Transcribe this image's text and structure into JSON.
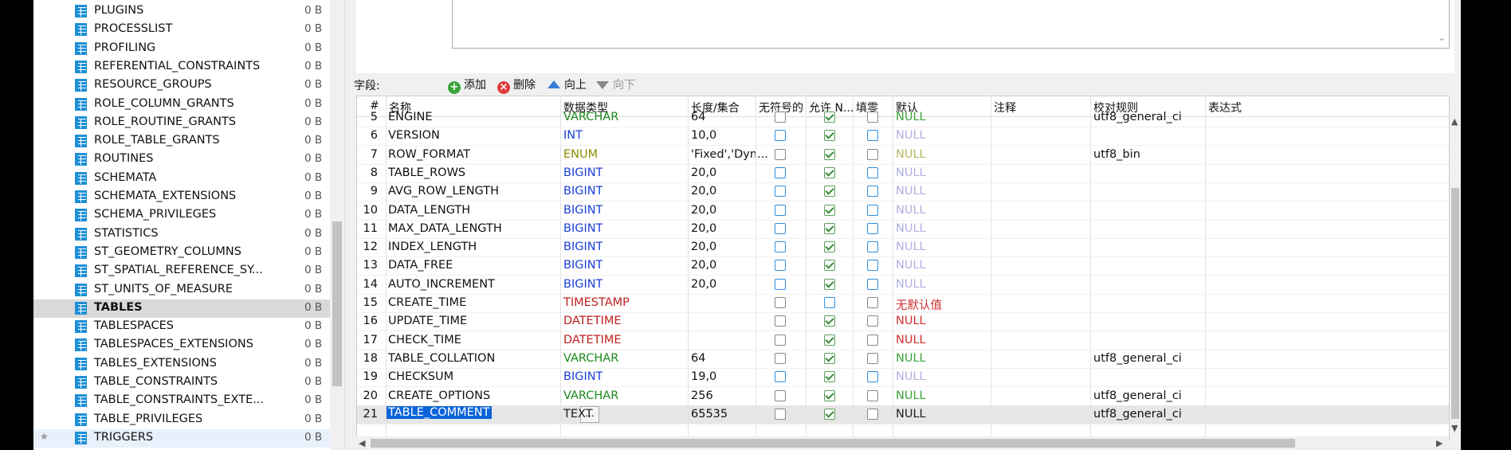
{
  "tree": {
    "items": [
      {
        "name": "PLUGINS",
        "size": "0 B"
      },
      {
        "name": "PROCESSLIST",
        "size": "0 B"
      },
      {
        "name": "PROFILING",
        "size": "0 B"
      },
      {
        "name": "REFERENTIAL_CONSTRAINTS",
        "size": "0 B"
      },
      {
        "name": "RESOURCE_GROUPS",
        "size": "0 B"
      },
      {
        "name": "ROLE_COLUMN_GRANTS",
        "size": "0 B"
      },
      {
        "name": "ROLE_ROUTINE_GRANTS",
        "size": "0 B"
      },
      {
        "name": "ROLE_TABLE_GRANTS",
        "size": "0 B"
      },
      {
        "name": "ROUTINES",
        "size": "0 B"
      },
      {
        "name": "SCHEMATA",
        "size": "0 B"
      },
      {
        "name": "SCHEMATA_EXTENSIONS",
        "size": "0 B"
      },
      {
        "name": "SCHEMA_PRIVILEGES",
        "size": "0 B"
      },
      {
        "name": "STATISTICS",
        "size": "0 B"
      },
      {
        "name": "ST_GEOMETRY_COLUMNS",
        "size": "0 B"
      },
      {
        "name": "ST_SPATIAL_REFERENCE_SY...",
        "size": "0 B"
      },
      {
        "name": "ST_UNITS_OF_MEASURE",
        "size": "0 B"
      },
      {
        "name": "TABLES",
        "size": "0 B"
      },
      {
        "name": "TABLESPACES",
        "size": "0 B"
      },
      {
        "name": "TABLESPACES_EXTENSIONS",
        "size": "0 B"
      },
      {
        "name": "TABLES_EXTENSIONS",
        "size": "0 B"
      },
      {
        "name": "TABLE_CONSTRAINTS",
        "size": "0 B"
      },
      {
        "name": "TABLE_CONSTRAINTS_EXTE...",
        "size": "0 B"
      },
      {
        "name": "TABLE_PRIVILEGES",
        "size": "0 B"
      },
      {
        "name": "TRIGGERS",
        "size": "0 B"
      }
    ],
    "selected_index": 16,
    "highlight_index": 23,
    "star": "★"
  },
  "toolbar": {
    "fields_label": "字段:",
    "add": "添加",
    "delete": "删除",
    "up": "向上",
    "down": "向下"
  },
  "grid": {
    "headers": [
      "#",
      "名称",
      "数据类型",
      "长度/集合",
      "无符号的",
      "允许 N...",
      "填零",
      "默认",
      "注释",
      "校对规则",
      "表达式"
    ],
    "colors": {
      "VARCHAR": "#1a8a1a",
      "INT": "#1a3fd6",
      "BIGINT": "#1a3fd6",
      "ENUM": "#8a8a00",
      "TIMESTAMP": "#c02020",
      "DATETIME": "#c02020",
      "TEXT": "#222222"
    },
    "rows": [
      {
        "num": "5",
        "name": "ENGINE",
        "type": "VARCHAR",
        "len": "64",
        "unsigned": "off",
        "allow_null": "on",
        "zerofill": "off",
        "default": "NULL",
        "default_color": "#3aa53a",
        "collation": "utf8_general_ci"
      },
      {
        "num": "6",
        "name": "VERSION",
        "type": "INT",
        "len": "10,0",
        "unsigned": "blue",
        "allow_null": "on",
        "zerofill": "blue",
        "default": "NULL",
        "default_color": "#b0b0e0",
        "collation": ""
      },
      {
        "num": "7",
        "name": "ROW_FORMAT",
        "type": "ENUM",
        "len": "'Fixed','Dyn...",
        "unsigned": "off",
        "allow_null": "on",
        "zerofill": "off",
        "default": "NULL",
        "default_color": "#b5b560",
        "collation": "utf8_bin"
      },
      {
        "num": "8",
        "name": "TABLE_ROWS",
        "type": "BIGINT",
        "len": "20,0",
        "unsigned": "blue",
        "allow_null": "on",
        "zerofill": "blue",
        "default": "NULL",
        "default_color": "#b0b0e0",
        "collation": ""
      },
      {
        "num": "9",
        "name": "AVG_ROW_LENGTH",
        "type": "BIGINT",
        "len": "20,0",
        "unsigned": "blue",
        "allow_null": "on",
        "zerofill": "blue",
        "default": "NULL",
        "default_color": "#b0b0e0",
        "collation": ""
      },
      {
        "num": "10",
        "name": "DATA_LENGTH",
        "type": "BIGINT",
        "len": "20,0",
        "unsigned": "blue",
        "allow_null": "on",
        "zerofill": "blue",
        "default": "NULL",
        "default_color": "#b0b0e0",
        "collation": ""
      },
      {
        "num": "11",
        "name": "MAX_DATA_LENGTH",
        "type": "BIGINT",
        "len": "20,0",
        "unsigned": "blue",
        "allow_null": "on",
        "zerofill": "blue",
        "default": "NULL",
        "default_color": "#b0b0e0",
        "collation": ""
      },
      {
        "num": "12",
        "name": "INDEX_LENGTH",
        "type": "BIGINT",
        "len": "20,0",
        "unsigned": "blue",
        "allow_null": "on",
        "zerofill": "blue",
        "default": "NULL",
        "default_color": "#b0b0e0",
        "collation": ""
      },
      {
        "num": "13",
        "name": "DATA_FREE",
        "type": "BIGINT",
        "len": "20,0",
        "unsigned": "blue",
        "allow_null": "on",
        "zerofill": "blue",
        "default": "NULL",
        "default_color": "#b0b0e0",
        "collation": ""
      },
      {
        "num": "14",
        "name": "AUTO_INCREMENT",
        "type": "BIGINT",
        "len": "20,0",
        "unsigned": "blue",
        "allow_null": "on",
        "zerofill": "blue",
        "default": "NULL",
        "default_color": "#b0b0e0",
        "collation": ""
      },
      {
        "num": "15",
        "name": "CREATE_TIME",
        "type": "TIMESTAMP",
        "len": "",
        "unsigned": "off",
        "allow_null": "blue",
        "zerofill": "off",
        "default": "无默认值",
        "default_color": "#d03030",
        "collation": ""
      },
      {
        "num": "16",
        "name": "UPDATE_TIME",
        "type": "DATETIME",
        "len": "",
        "unsigned": "off",
        "allow_null": "on",
        "zerofill": "off",
        "default": "NULL",
        "default_color": "#d03030",
        "collation": ""
      },
      {
        "num": "17",
        "name": "CHECK_TIME",
        "type": "DATETIME",
        "len": "",
        "unsigned": "off",
        "allow_null": "on",
        "zerofill": "off",
        "default": "NULL",
        "default_color": "#d03030",
        "collation": ""
      },
      {
        "num": "18",
        "name": "TABLE_COLLATION",
        "type": "VARCHAR",
        "len": "64",
        "unsigned": "off",
        "allow_null": "on",
        "zerofill": "off",
        "default": "NULL",
        "default_color": "#3aa53a",
        "collation": "utf8_general_ci"
      },
      {
        "num": "19",
        "name": "CHECKSUM",
        "type": "BIGINT",
        "len": "19,0",
        "unsigned": "blue",
        "allow_null": "on",
        "zerofill": "blue",
        "default": "NULL",
        "default_color": "#b0b0e0",
        "collation": ""
      },
      {
        "num": "20",
        "name": "CREATE_OPTIONS",
        "type": "VARCHAR",
        "len": "256",
        "unsigned": "off",
        "allow_null": "on",
        "zerofill": "off",
        "default": "NULL",
        "default_color": "#3aa53a",
        "collation": "utf8_general_ci"
      },
      {
        "num": "21",
        "name": "TABLE_COMMENT",
        "type": "TEXT",
        "len": "65535",
        "unsigned": "off",
        "allow_null": "on",
        "zerofill": "off",
        "default": "NULL",
        "default_color": "#222222",
        "collation": "utf8_general_ci"
      }
    ],
    "selected_index": 16,
    "edit_button": "..."
  }
}
